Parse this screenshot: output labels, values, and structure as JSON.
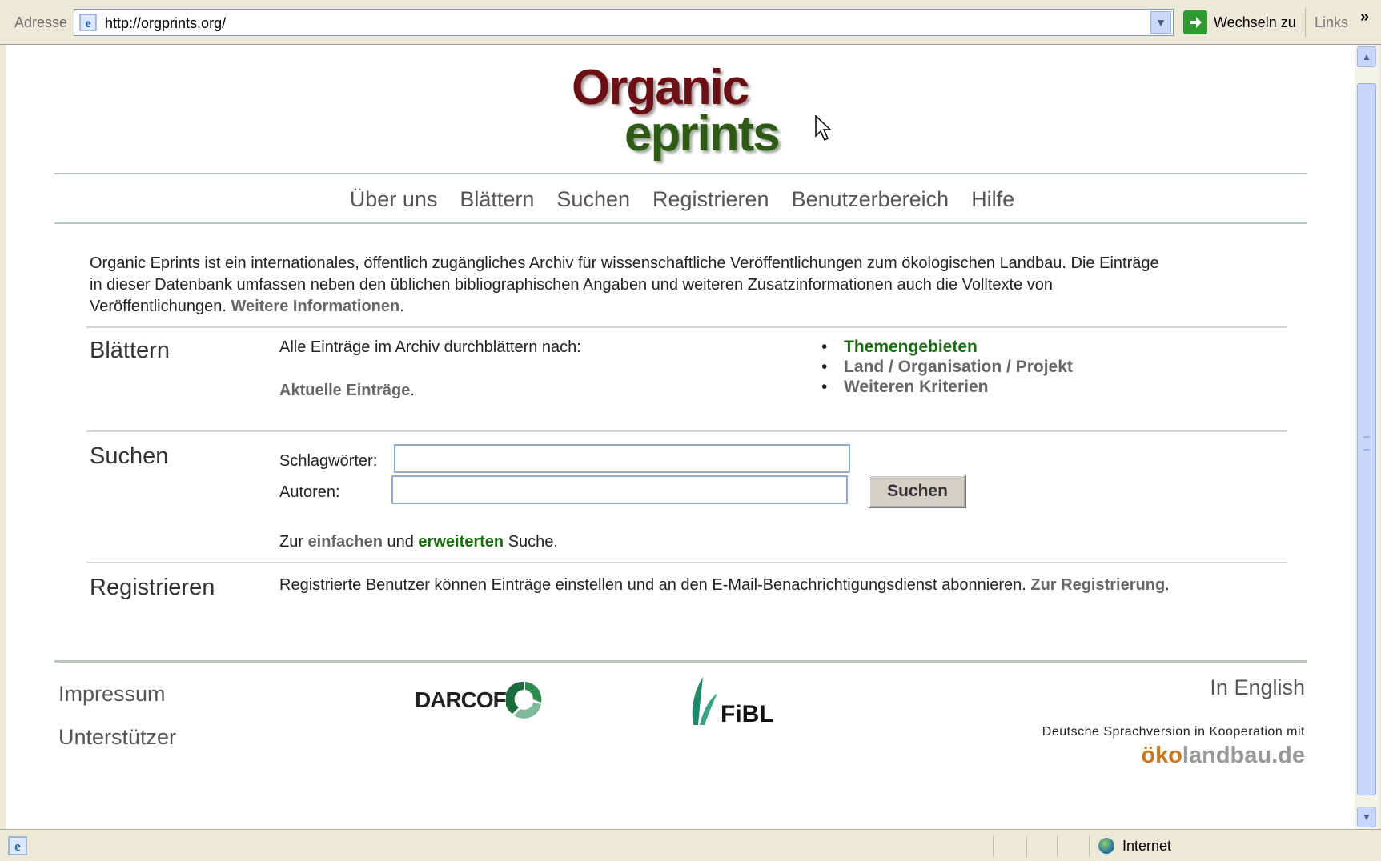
{
  "addressbar": {
    "label": "Adresse",
    "url": "http://orgprints.org/",
    "go_label": "Wechseln zu",
    "links_label": "Links",
    "chevron": "»"
  },
  "logo": {
    "line1": "Organic",
    "line2": "eprints"
  },
  "menu": [
    "Über uns",
    "Blättern",
    "Suchen",
    "Registrieren",
    "Benutzerbereich",
    "Hilfe"
  ],
  "intro": {
    "text_line1": "Organic Eprints ist ein internationales, öffentlich zugängliches Archiv für wissenschaftliche Veröffentlichungen zum ökologischen Landbau. Die Einträge",
    "text_line2": "in dieser Datenbank umfassen neben den üblichen bibliographischen Angaben und weiteren Zusatzinformationen auch die Volltexte von",
    "text_line3": "Veröffentlichungen.",
    "more_link": "Weitere Informationen",
    "period": "."
  },
  "browse": {
    "title": "Blättern",
    "desc": "Alle Einträge im Archiv durchblättern nach:",
    "recent_link": "Aktuelle Einträge",
    "recent_period": ".",
    "options": [
      "Themengebieten",
      "Land / Organisation / Projekt",
      "Weiteren Kriterien"
    ]
  },
  "search": {
    "title": "Suchen",
    "keywords_label": "Schlagwörter:",
    "authors_label": "Autoren:",
    "keywords_value": "",
    "authors_value": "",
    "button": "Suchen",
    "footer_prefix": "Zur",
    "simple_link": "einfachen",
    "and": "und",
    "advanced_link": "erweiterten",
    "footer_suffix": "Suche."
  },
  "register": {
    "title": "Registrieren",
    "text": "Registrierte Benutzer können Einträge einstellen und an den E-Mail-Benachrichtigungsdienst abonnieren.",
    "link": "Zur Registrierung",
    "period": "."
  },
  "footer": {
    "impressum": "Impressum",
    "supporters": "Unterstützer",
    "darcof": "DARCOF",
    "fibl": "FiBL",
    "english": "In English",
    "koop": "Deutsche Sprachversion in Kooperation mit",
    "oeko_a": "ö",
    "oeko_b": "ko",
    "oeko_c": "landbau.de"
  },
  "statusbar": {
    "zone": "Internet"
  },
  "colors": {
    "green_link": "#1b6a12",
    "grey_link": "#666666",
    "logo_red": "#6b1015",
    "logo_green": "#2e5a16"
  }
}
